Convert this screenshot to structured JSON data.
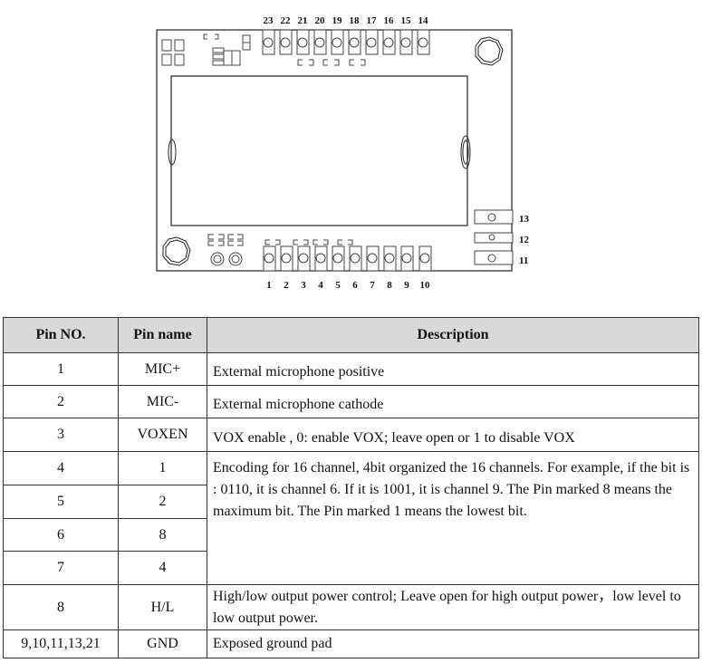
{
  "diagram": {
    "top_pins": [
      "23",
      "22",
      "21",
      "20",
      "19",
      "18",
      "17",
      "16",
      "15",
      "14"
    ],
    "bottom_pins": [
      "1",
      "2",
      "3",
      "4",
      "5",
      "6",
      "7",
      "8",
      "9",
      "10"
    ],
    "side_pins": [
      "13",
      "12",
      "11"
    ]
  },
  "table": {
    "headers": [
      "Pin NO.",
      "Pin name",
      "Description"
    ],
    "rows": [
      {
        "pin_no": "1",
        "pin_name": "MIC+",
        "description": "External microphone positive"
      },
      {
        "pin_no": "2",
        "pin_name": "MIC-",
        "description": "External microphone cathode"
      },
      {
        "pin_no": "3",
        "pin_name": "VOXEN",
        "description": "VOX enable , 0: enable VOX; leave open or 1 to disable VOX"
      },
      {
        "pin_no": "4",
        "pin_name": "1",
        "description": "Encoding for 16 channel, 4bit organized the 16 channels. For example, if the bit is : 0110, it is channel 6. If it is 1001, it is channel 9. The Pin marked 8 means the maximum bit. The Pin marked 1 means the lowest bit."
      },
      {
        "pin_no": "5",
        "pin_name": "2"
      },
      {
        "pin_no": "6",
        "pin_name": "8"
      },
      {
        "pin_no": "7",
        "pin_name": "4"
      },
      {
        "pin_no": "8",
        "pin_name": "H/L",
        "description": "High/low output power control; Leave open for high output power，low level to low output power."
      },
      {
        "pin_no": "9,10,11,13,21",
        "pin_name": "GND",
        "description": "Exposed ground pad"
      }
    ]
  }
}
